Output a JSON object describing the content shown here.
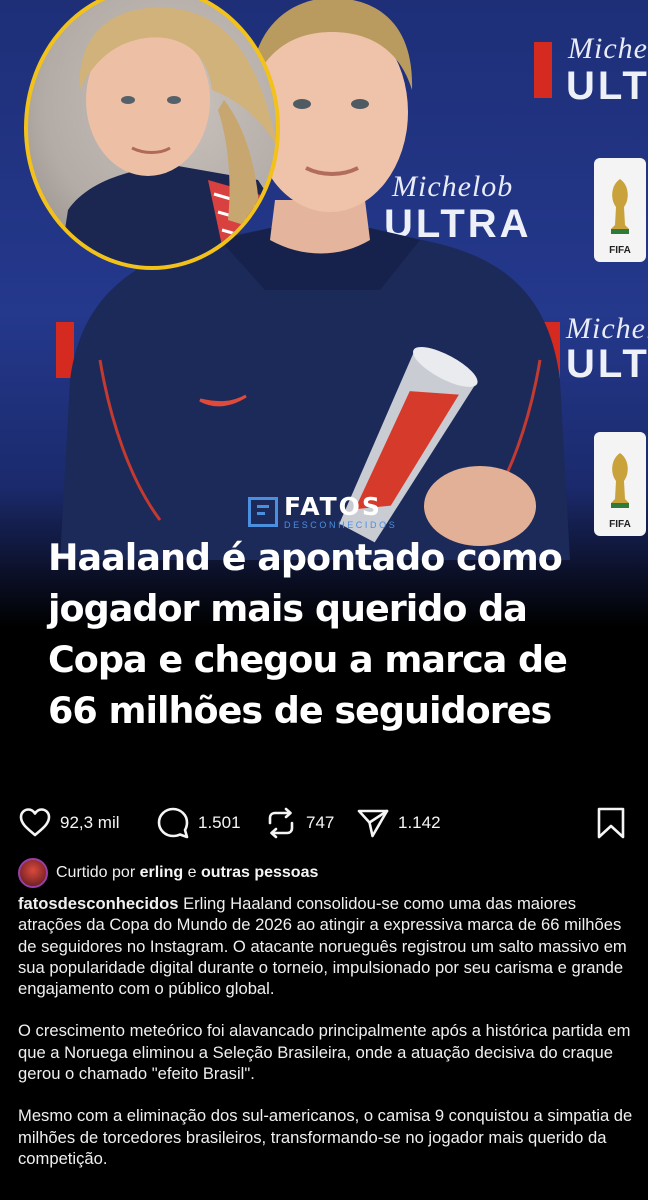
{
  "post": {
    "logo_main": "FATOS",
    "logo_sub": "DESCONHECIDOS",
    "headline": "Haaland é apontado como jogador mais querido da Copa e chegou a marca de 66 milhões de seguidores",
    "sponsor_text": [
      "Michelob",
      "ULTRA"
    ],
    "badge_text": "FIFA"
  },
  "actions": {
    "likes": "92,3 mil",
    "comments": "1.501",
    "reposts": "747",
    "shares": "1.142"
  },
  "liked_by": {
    "prefix": "Curtido por",
    "user": "erling",
    "conj": "e",
    "others": "outras pessoas"
  },
  "caption": {
    "username": "fatosdesconhecidos",
    "p1": "Erling Haaland consolidou-se como uma das maiores atrações da Copa do Mundo de 2026 ao atingir a expressiva marca de 66 milhões de seguidores no Instagram. O atacante norueguês registrou um salto massivo em sua popularidade digital durante o torneio, impulsionado por seu carisma e grande engajamento com o público global.",
    "p2": "O crescimento meteórico foi alavancado principalmente após a histórica partida em que a Noruega eliminou a Seleção Brasileira, onde a atuação decisiva do craque gerou o chamado \"efeito Brasil\".",
    "p3": "Mesmo com a eliminação dos sul-americanos, o camisa 9 conquistou a simpatia de milhões de torcedores brasileiros, transformando-se no jogador mais querido da competição."
  },
  "colors": {
    "background": "#000000",
    "text": "#f5f5f5",
    "brand_blue": "#4a8fe0",
    "inset_ring": "#f2c21a",
    "jersey": "#1c2a5a",
    "sponsor_red": "#d52a1f"
  }
}
